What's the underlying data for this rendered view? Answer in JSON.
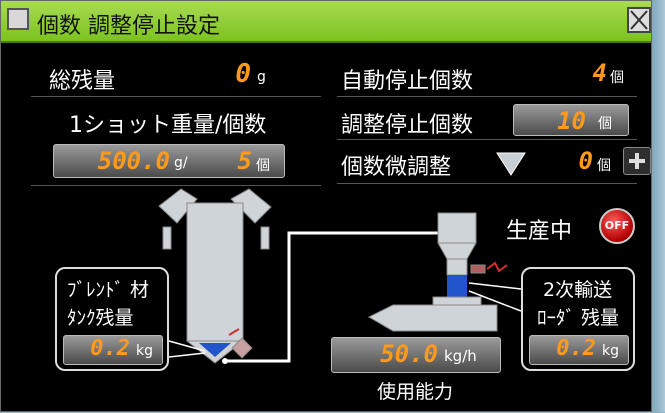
{
  "window": {
    "title": "個数 調整停止設定",
    "close_symbol": "✕"
  },
  "summary": {
    "total_remaining_label": "総残量",
    "total_remaining_value": "0",
    "total_remaining_unit": "g",
    "per_shot_label": "1ショット重量/個数",
    "shot_weight_value": "500.0",
    "shot_weight_unit": "g/",
    "shot_count_value": "5",
    "shot_count_unit": "個"
  },
  "stop_settings": {
    "auto_stop_label": "自動停止個数",
    "auto_stop_value": "4",
    "auto_stop_unit": "個",
    "adjust_stop_label": "調整停止個数",
    "adjust_stop_value": "10",
    "adjust_stop_unit": "個",
    "fine_adjust_label": "個数微調整",
    "fine_adjust_value": "0",
    "fine_adjust_unit": "個"
  },
  "status": {
    "producing_label": "生産中",
    "off_label": "OFF"
  },
  "blend_tank": {
    "label_line1": "ﾌﾞﾚﾝﾄﾞ 材",
    "label_line2": "ﾀﾝｸ残量",
    "value": "0.2",
    "unit": "kg"
  },
  "secondary_loader": {
    "label_line1": "2次輸送",
    "label_line2": "ﾛｰﾀﾞ 残量",
    "value": "0.2",
    "unit": "kg"
  },
  "capacity": {
    "value": "50.0",
    "unit": "kg/h",
    "label": "使用能力"
  },
  "colors": {
    "title_bar": "#8ccf33",
    "segment_digits": "#ff9a1a",
    "material_blue": "#2255cc",
    "off_button": "#d01010"
  }
}
